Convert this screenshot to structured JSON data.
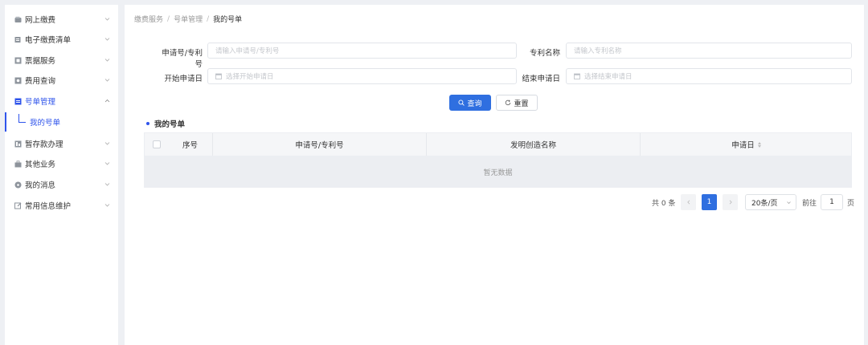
{
  "sidebar": {
    "items": [
      {
        "label": "网上缴费",
        "icon": "wallet-icon",
        "expanded": false
      },
      {
        "label": "电子缴费清单",
        "icon": "list-icon",
        "expanded": false
      },
      {
        "label": "票据服务",
        "icon": "receipt-icon",
        "expanded": false
      },
      {
        "label": "费用查询",
        "icon": "search-doc-icon",
        "expanded": false
      },
      {
        "label": "号单管理",
        "icon": "document-icon",
        "expanded": true,
        "active": true
      },
      {
        "label": "暂存款办理",
        "icon": "deposit-icon",
        "expanded": false
      },
      {
        "label": "其他业务",
        "icon": "briefcase-icon",
        "expanded": false
      },
      {
        "label": "我的消息",
        "icon": "message-icon",
        "expanded": false
      },
      {
        "label": "常用信息维护",
        "icon": "edit-icon",
        "expanded": false
      }
    ],
    "sub_item": {
      "label": "我的号单"
    }
  },
  "breadcrumb": [
    "缴费服务",
    "号单管理",
    "我的号单"
  ],
  "search": {
    "app_no_label": "申请号/专利号",
    "app_no_placeholder": "请输入申请号/专利号",
    "patent_name_label": "专利名称",
    "patent_name_placeholder": "请输入专利名称",
    "start_date_label": "开始申请日",
    "start_date_placeholder": "选择开始申请日",
    "end_date_label": "结束申请日",
    "end_date_placeholder": "选择结束申请日",
    "query_button": "查询",
    "reset_button": "重置"
  },
  "section_title": "我的号单",
  "table": {
    "columns": [
      "序号",
      "申请号/专利号",
      "发明创造名称",
      "申请日"
    ],
    "empty_text": "暂无数据"
  },
  "pagination": {
    "total_text": "共 0 条",
    "current_page": "1",
    "page_size": "20条/页",
    "goto_label": "前往",
    "goto_value": "1",
    "page_unit": "页"
  },
  "colors": {
    "accent": "#2f6fe0",
    "active_text": "#2f54eb"
  }
}
